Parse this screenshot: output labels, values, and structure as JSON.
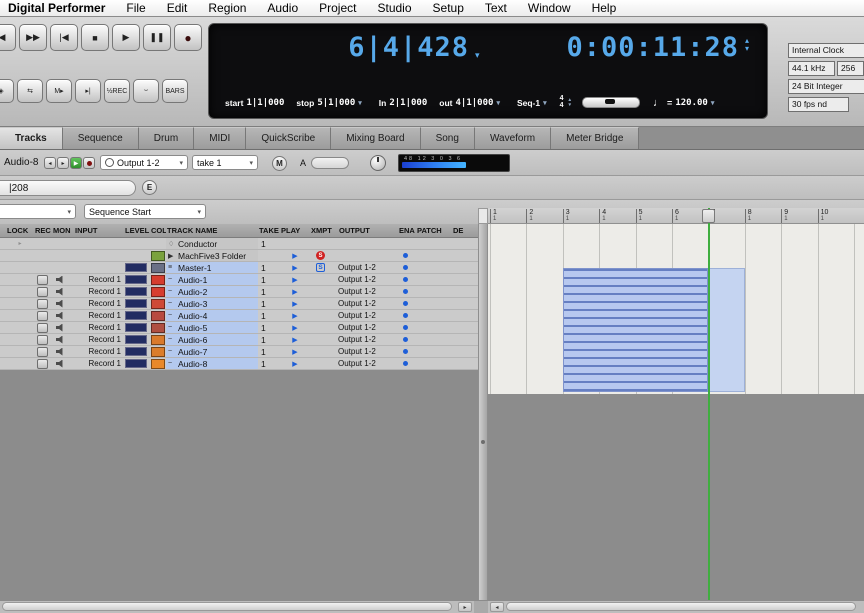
{
  "menu_bar": {
    "app_name": "Digital Performer",
    "items": [
      "File",
      "Edit",
      "Region",
      "Audio",
      "Project",
      "Studio",
      "Setup",
      "Text",
      "Window",
      "Help"
    ]
  },
  "icons": {
    "dropdown": "▾",
    "up": "▴",
    "down": "▾",
    "note": "♩"
  },
  "transport": {
    "buttons": [
      {
        "name": "step-back",
        "glyph": "◀"
      },
      {
        "name": "fast-forward",
        "glyph": "▶▶"
      },
      {
        "name": "return-to-start",
        "glyph": "|◀"
      },
      {
        "name": "stop",
        "glyph": "■"
      },
      {
        "name": "play",
        "glyph": "▶"
      },
      {
        "name": "pause",
        "glyph": "❚❚"
      },
      {
        "name": "record",
        "glyph": "●"
      }
    ],
    "secondary_buttons": [
      {
        "name": "overdub",
        "glyph": "◈"
      },
      {
        "name": "loop",
        "glyph": "⇆"
      },
      {
        "name": "memory-play",
        "glyph": "M▸"
      },
      {
        "name": "punch-in",
        "glyph": "▸|"
      },
      {
        "name": "half-speed-record",
        "glyph": "½REC"
      },
      {
        "name": "slur",
        "glyph": "⌣"
      },
      {
        "name": "bars",
        "glyph": "BARS"
      }
    ],
    "counter": "6|4|428",
    "timecode": "0:00:11:28",
    "start_label": "start",
    "start_value": "1|1|000",
    "stop_label": "stop",
    "stop_value": "5|1|000",
    "in_label": "In",
    "in_value": "2|1|000",
    "out_label": "out",
    "out_value": "4|1|000",
    "sequence": "Seq-1",
    "meter_numerator": "4",
    "meter_denominator": "4",
    "tempo_equals": "=",
    "tempo": "120.00"
  },
  "clock_panel": {
    "clock_source": "Internal Clock",
    "sample_rate": "44.1 kHz",
    "buffer_size": "256",
    "bit_depth": "24 Bit Integer",
    "frame_rate": "30 fps nd"
  },
  "tabs": [
    {
      "label": "Tracks",
      "active": true
    },
    {
      "label": "Sequence",
      "active": false
    },
    {
      "label": "Drum",
      "active": false
    },
    {
      "label": "MIDI",
      "active": false
    },
    {
      "label": "QuickScribe",
      "active": false
    },
    {
      "label": "Mixing Board",
      "active": false
    },
    {
      "label": "Song",
      "active": false
    },
    {
      "label": "Waveform",
      "active": false
    },
    {
      "label": "Meter Bridge",
      "active": false
    }
  ],
  "track_info": {
    "selected_track": "Audio-8",
    "output": "Output 1-2",
    "take": "take 1",
    "mute_label": "M",
    "auto_label": "A",
    "meter_scale": "48 12 3 0 3 6"
  },
  "position_bar": {
    "value": "|208",
    "edit_label": "E"
  },
  "selector_bar": {
    "left_value": "",
    "right_value": "Sequence Start"
  },
  "track_table": {
    "headers": [
      "LOCK",
      "REC",
      "MON",
      "INPUT",
      "LEVEL",
      "COL",
      "TRACK NAME",
      "TAKE",
      "PLAY",
      "XMPT",
      "OUTPUT",
      "ENA",
      "PATCH",
      "DE"
    ],
    "rows": [
      {
        "icon": "♢",
        "name": "Conductor",
        "lock": "▸",
        "rec": false,
        "mon": false,
        "input": "",
        "level": false,
        "color": "",
        "selected": false,
        "take": "1",
        "play": false,
        "xmpt": "",
        "output": "",
        "ena": false
      },
      {
        "icon": "▶",
        "name": "MachFive3 Folder",
        "lock": "",
        "rec": false,
        "mon": false,
        "input": "",
        "level": false,
        "color": "#7aa23d",
        "selected": false,
        "take": "",
        "play": true,
        "xmpt": "red",
        "output": "",
        "ena": true
      },
      {
        "icon": "≡",
        "name": "Master-1",
        "lock": "",
        "rec": false,
        "mon": false,
        "input": "",
        "level": true,
        "color": "#6a7086",
        "selected": true,
        "take": "1",
        "play": true,
        "xmpt": "blue",
        "output": "Output 1-2",
        "ena": true
      },
      {
        "icon": "~",
        "name": "Audio-1",
        "lock": "",
        "rec": true,
        "mon": true,
        "input": "Record 1",
        "level": true,
        "color": "#d63d2f",
        "selected": true,
        "take": "1",
        "play": true,
        "xmpt": "",
        "output": "Output 1-2",
        "ena": true
      },
      {
        "icon": "~",
        "name": "Audio-2",
        "lock": "",
        "rec": true,
        "mon": true,
        "input": "Record 1",
        "level": true,
        "color": "#d63d2f",
        "selected": true,
        "take": "1",
        "play": true,
        "xmpt": "",
        "output": "Output 1-2",
        "ena": true
      },
      {
        "icon": "~",
        "name": "Audio-3",
        "lock": "",
        "rec": true,
        "mon": true,
        "input": "Record 1",
        "level": true,
        "color": "#ce4936",
        "selected": true,
        "take": "1",
        "play": true,
        "xmpt": "",
        "output": "Output 1-2",
        "ena": true
      },
      {
        "icon": "~",
        "name": "Audio-4",
        "lock": "",
        "rec": true,
        "mon": true,
        "input": "Record 1",
        "level": true,
        "color": "#b84a40",
        "selected": true,
        "take": "1",
        "play": true,
        "xmpt": "",
        "output": "Output 1-2",
        "ena": true
      },
      {
        "icon": "~",
        "name": "Audio-5",
        "lock": "",
        "rec": true,
        "mon": true,
        "input": "Record 1",
        "level": true,
        "color": "#b04f41",
        "selected": true,
        "take": "1",
        "play": true,
        "xmpt": "",
        "output": "Output 1-2",
        "ena": true
      },
      {
        "icon": "~",
        "name": "Audio-6",
        "lock": "",
        "rec": true,
        "mon": true,
        "input": "Record 1",
        "level": true,
        "color": "#d97a2c",
        "selected": true,
        "take": "1",
        "play": true,
        "xmpt": "",
        "output": "Output 1-2",
        "ena": true
      },
      {
        "icon": "~",
        "name": "Audio-7",
        "lock": "",
        "rec": true,
        "mon": true,
        "input": "Record 1",
        "level": true,
        "color": "#db7d2b",
        "selected": true,
        "take": "1",
        "play": true,
        "xmpt": "",
        "output": "Output 1-2",
        "ena": true
      },
      {
        "icon": "~",
        "name": "Audio-8",
        "lock": "",
        "rec": true,
        "mon": true,
        "input": "Record 1",
        "level": true,
        "color": "#e8882a",
        "selected": true,
        "take": "1",
        "play": true,
        "xmpt": "",
        "output": "Output 1-2",
        "ena": true
      }
    ]
  },
  "ruler": {
    "bars": [
      "1",
      "2",
      "3",
      "4",
      "5",
      "6",
      "7",
      "8",
      "9",
      "10"
    ],
    "beat_label": "1"
  },
  "arrangement": {
    "clip_start_bar": 3,
    "clip_end_bar": 8,
    "playhead_bar": 7,
    "clip_track_count": 8
  },
  "colors": {
    "lcd_text": "#57a9ea",
    "accent_blue": "#1d5ed8",
    "playhead_green": "#3fae3f",
    "selection_blue": "#b4c9ee",
    "level_navy": "#222c62"
  }
}
